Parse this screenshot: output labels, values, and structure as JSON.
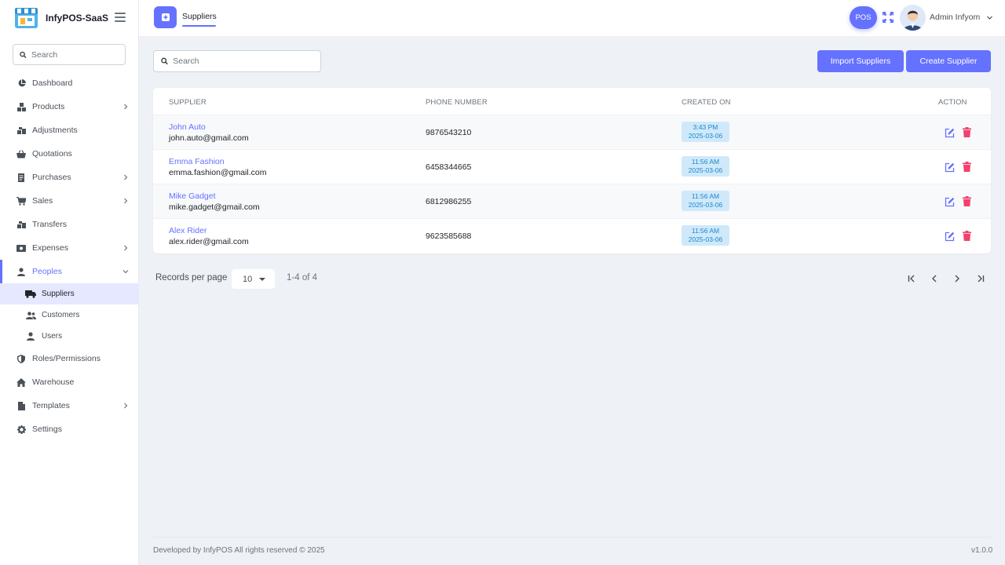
{
  "app": {
    "name": "InfyPOS-SaaS"
  },
  "sidebar": {
    "search_placeholder": "Search",
    "items": [
      {
        "label": "Dashboard",
        "icon": "dashboard-icon"
      },
      {
        "label": "Products",
        "icon": "products-icon"
      },
      {
        "label": "Adjustments",
        "icon": "adjustments-icon"
      },
      {
        "label": "Quotations",
        "icon": "basket-icon"
      },
      {
        "label": "Purchases",
        "icon": "receipt-icon"
      },
      {
        "label": "Sales",
        "icon": "cart-icon"
      },
      {
        "label": "Transfers",
        "icon": "transfers-icon"
      },
      {
        "label": "Expenses",
        "icon": "money-icon"
      },
      {
        "label": "Peoples",
        "icon": "user-icon"
      },
      {
        "label": "Roles/Permissions",
        "icon": "shield-icon"
      },
      {
        "label": "Warehouse",
        "icon": "home-icon"
      },
      {
        "label": "Templates",
        "icon": "file-icon"
      },
      {
        "label": "Settings",
        "icon": "gear-icon"
      }
    ],
    "sub_items": [
      {
        "label": "Suppliers",
        "icon": "truck-icon"
      },
      {
        "label": "Customers",
        "icon": "users-icon"
      },
      {
        "label": "Users",
        "icon": "user-icon"
      }
    ]
  },
  "header": {
    "tab": "Suppliers",
    "pos_label": "POS",
    "user_name": "Admin Infyom"
  },
  "main": {
    "search_placeholder": "Search",
    "import_button": "Import Suppliers",
    "create_button": "Create Supplier",
    "columns": [
      "SUPPLIER",
      "PHONE NUMBER",
      "CREATED ON",
      "ACTION"
    ],
    "rows": [
      {
        "name": "John Auto",
        "email": "john.auto@gmail.com",
        "phone": "9876543210",
        "time": "3:43 PM",
        "date": "2025-03-06"
      },
      {
        "name": "Emma Fashion",
        "email": "emma.fashion@gmail.com",
        "phone": "6458344665",
        "time": "11:56 AM",
        "date": "2025-03-06"
      },
      {
        "name": "Mike Gadget",
        "email": "mike.gadget@gmail.com",
        "phone": "6812986255",
        "time": "11:56 AM",
        "date": "2025-03-06"
      },
      {
        "name": "Alex Rider",
        "email": "alex.rider@gmail.com",
        "phone": "9623585688",
        "time": "11:56 AM",
        "date": "2025-03-06"
      }
    ],
    "pagination": {
      "records_label": "Records per page",
      "per_page": "10",
      "range": "1-4 of 4"
    }
  },
  "footer": {
    "left": "Developed by InfyPOS All rights reserved © 2025",
    "version": "v1.0.0"
  },
  "colors": {
    "accent": "#6571ff",
    "danger": "#f1416c",
    "badge_bg": "#cfe9fb",
    "badge_text": "#1e88c9"
  }
}
